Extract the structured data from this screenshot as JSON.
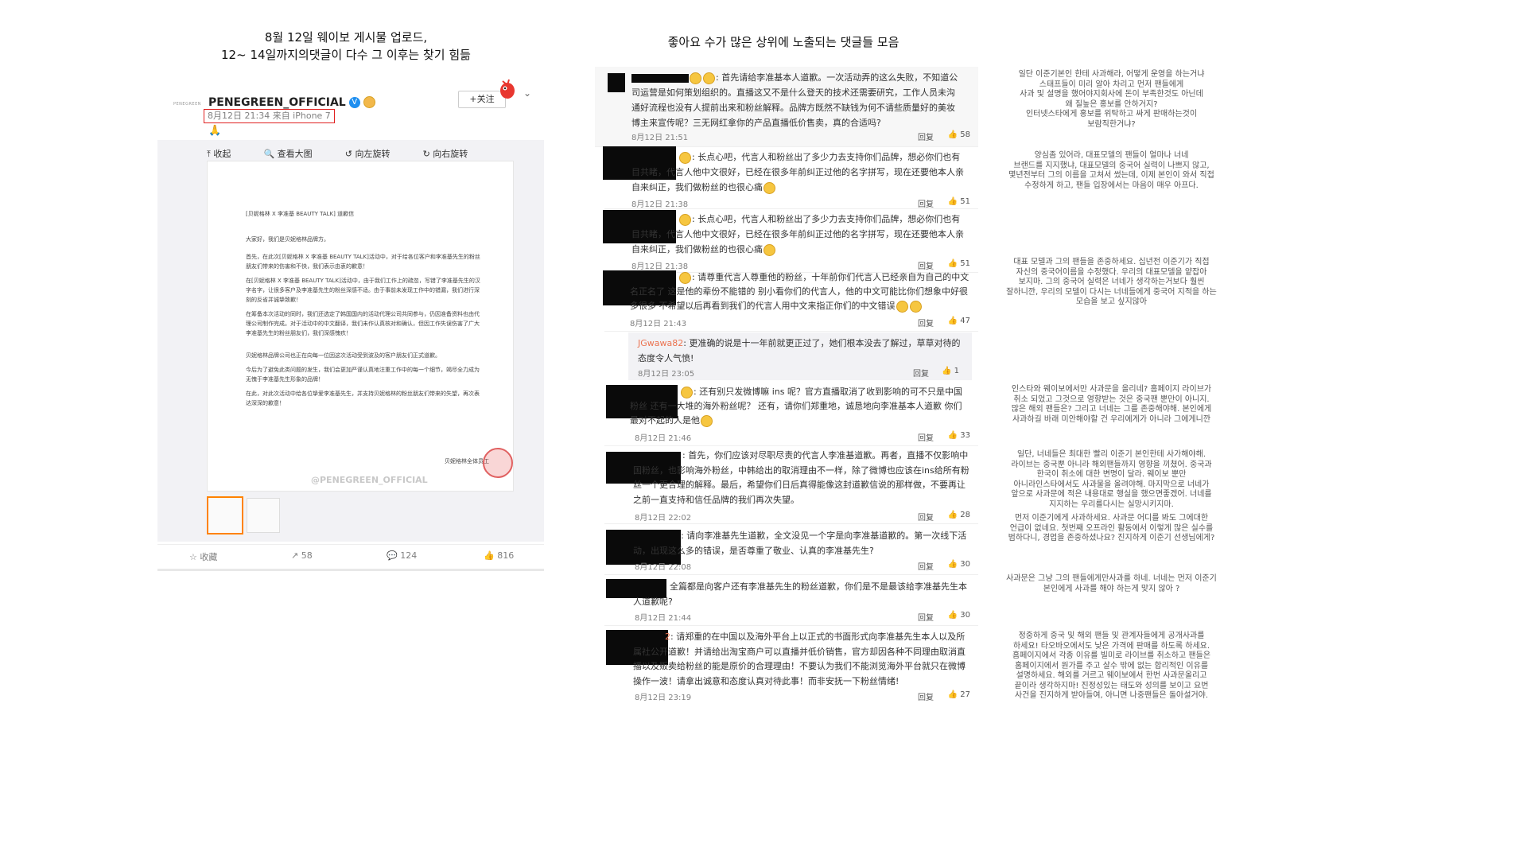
{
  "headers": {
    "left_line1": "8월 12일 웨이보 게시물 업로드,",
    "left_line2": "12~ 14일까지의댓글이 다수 그 이후는 찾기 힘듦",
    "right": "좋아요 수가 많은 상위에 노출되는 댓글들 모음"
  },
  "post": {
    "logo_text": "PENEGREEN",
    "account": "PENEGREEN_OFFICIAL",
    "verified": "V",
    "time": "8月12日 21:34 来自 iPhone 7",
    "follow": "+关注",
    "toolbar": [
      "收起",
      "查看大图",
      "向左旋转",
      "向右旋转"
    ],
    "document": {
      "title": "[贝妮格林 X 李准基 BEAUTY TALK] 道歉信",
      "greeting": "大家好，我们是贝妮格林品牌方。",
      "para1": "首先，在此次[贝妮格林 X 李准基 BEAUTY TALK]活动中，对于给各位客户和李准基先生的粉丝朋友们带来的伤害和不快，我们表示由衷的歉意！",
      "para2": "在[贝妮格林 X 李准基 BEAUTY TALK]活动中，由于我们工作上的疏忽，写错了李准基先生的汉字名字，让很多客户及李准基先生的粉丝深感不适。由于事前未发现工作中的错漏，我们进行深刻的反省并诚挚致歉！",
      "para3": "在筹备本次活动的同时，我们还选定了韩国国内的活动代理公司共同参与，仍因准备资料也由代理公司制作完成。对于活动中的中文翻译，我们未作认真核对和确认，但因工作失误伤害了广大李准基先生的粉丝朋友们，我们深感愧疚！",
      "para4": "贝妮格林品牌公司也正在向每一位因这次活动受到波及的客户朋友们正式道歉。",
      "para5": "今后为了避免此类问题的发生，我们会更加严谨认真地注重工作中的每一个细节，竭尽全力成为无愧于李准基先生形象的品牌！",
      "para6": "在此，对此次活动中给各位挚爱李准基先生，并支持贝妮格林的粉丝朋友们带来的失望，再次表达深深的歉意！",
      "signature": "贝妮格林全体员工",
      "watermark": "@PENEGREEN_OFFICIAL"
    },
    "actions": {
      "favorite": "收藏",
      "forward": "58",
      "comment": "124",
      "like": "816"
    }
  },
  "comments": [
    {
      "text": "首先请给李准基本人道歉。一次活动弄的这么失败，不知道公司运营是如何策划组织的。直播这又不是什么登天的技术还需要研究，工作人员未沟通好流程也没有人提前出来和粉丝解释。品牌方既然不缺钱为何不请些质量好的美妆博主来宣传呢？三无网红拿你的产品直播低价售卖，真的合适吗?",
      "date": "8月12日 21:51",
      "reply": "回复",
      "likes": "58"
    },
    {
      "text": "长点心吧，代言人和粉丝出了多少力去支持你们品牌，想必你们也有目共睹，代言人他中文很好，已经在很多年前纠正过他的名字拼写，现在还要他本人亲自来纠正，我们做粉丝的也很心痛",
      "date": "8月12日 21:38",
      "reply": "回复",
      "likes": "51"
    },
    {
      "text": "长点心吧，代言人和粉丝出了多少力去支持你们品牌，想必你们也有目共睹，代言人他中文很好，已经在很多年前纠正过他的名字拼写，现在还要他本人亲自来纠正，我们做粉丝的也很心痛",
      "date": "8月12日 21:38",
      "reply": "回复",
      "likes": "51"
    },
    {
      "text": "请尊重代言人尊重他的粉丝，十年前你们代言人已经亲自为自己的中文名正名了 这是他的辈份不能错的 别小看你们的代言人，他的中文可能比你们想象中好很多很多 不希望以后再看到我们的代言人用中文来指正你们的中文错误",
      "date": "8月12日 21:43",
      "reply": "回复",
      "likes": "47"
    },
    {
      "user": "JGwawa82",
      "text": "更准确的说是十一年前就更正过了，她们根本没去了解过，草草对待的态度令人气愤!",
      "date": "8月12日 23:05",
      "reply": "回复",
      "likes": "1"
    },
    {
      "text": "还有别只发微博嘛 ins 呢？官方直播取消了收到影响的可不只是中国粉丝 还有一大堆的海外粉丝呢？ 还有，请你们郑重地，诚恳地向李准基本人道歉 你们最对不起的人是他",
      "date": "8月12日 21:46",
      "reply": "回复",
      "likes": "33"
    },
    {
      "text": "首先，你们应该对尽职尽责的代言人李准基道歉。再者，直播不仅影响中国粉丝，也影响海外粉丝，中韩给出的取消理由不一样，除了微博也应该在ins给所有粉丝一个更合理的解释。最后，希望你们日后真得能像这封道歉信说的那样做，不要再让之前一直支持和信任品牌的我们再次失望。",
      "date": "8月12日 22:02",
      "reply": "回复",
      "likes": "28"
    },
    {
      "text": "请向李准基先生道歉，全文没见一个字是向李准基道歉的。第一次线下活动，出现这么多的错误，是否尊重了敬业、认真的李准基先生?",
      "date": "8月12日 22:08",
      "reply": "回复",
      "likes": "30"
    },
    {
      "text": "全篇都是向客户还有李准基先生的粉丝道歉，你们是不是最该给李准基先生本人道歉呢?",
      "date": "8月12日 21:44",
      "reply": "回复",
      "likes": "30"
    },
    {
      "user_suffix": "2",
      "text": "请郑重的在中国以及海外平台上以正式的书面形式向李准基先生本人以及所属社公开道歉！并请给出淘宝商户可以直播并低价销售，官方却因各种不同理由取消直播以及贩卖给粉丝的能是原价的合理理由！不要认为我们不能浏览海外平台就只在微博操作一波！请拿出诚意和态度认真对待此事！而非安抚一下粉丝情绪!",
      "date": "8月12日 23:19",
      "reply": "回复",
      "likes": "27"
    }
  ],
  "korean_notes": [
    "일단 이준기본인 한테 사과해라, 어떻게 운영을 하는거냐\n스태프들이 미리 알아 차리고 먼저 팬들에게\n사과 및 설명을 했어야지회사에 돈이 부족한것도 아닌데\n왜 질높은 홍보를 안하거지?\n인터넷스타에게 홍보를 위탁하고 싸게 판매하는것이\n보람직한거냐?",
    "양심좀 있어라, 대표모델의 팬들이 얼마나 너네\n브랜드를 지지했냐, 대표모델의 중국어 실력이 나쁘지 않고,\n몇년전부터 그의 이름을 고쳐서 썼는데, 이제 본인이 와서 직접\n수정하게 하고, 팬들 입장에서는 마음이 매우 아프다.",
    "대표 모델과 그의 팬들을 존중하세요. 십년전 이준기가 직접\n자신의 중국어이름을 수정했다. 우리의 대표모델을 얕잡아\n보지마. 그의 중국어 실력은 너네가 생각하는거보다 훨씬\n잘하니깐, 우리의 모델이 다시는 너네들에게 중국어 지적을 하는\n모습을 보고 싶지않아",
    "인스타와 웨이보에서만 사과문을 올리네? 홈페이지 라이브가\n취소 되었고 그것으로 영향받는 것은 중국팬 뿐만이 아니지.\n많은 해외 팬들은? 그리고 너네는 그를 존중해야해. 본인에게\n사과하길 바래 미안해야할 건 우리에게가 아니라 그에게니깐",
    "일단, 너네들은 최대한 빨리 이준기 본인한테 사가해야해.\n라이브는 중국뿐 아니라 해외팬들까지 영향을 끼쳤어. 중국과\n한국이 취소에 대한 변명이 달라. 웨이보 뿐만\n아니라인스타에서도 사과물을 올려야해. 마지막으로 너네가\n앞으로 사과문에 적은 내용대로 행실을 했으면좋겠어. 너네를\n지지하는 우리를다시는 실망시키지마.",
    "먼저 이준기에게 사과하세요. 사과문 어디를 봐도 그에대한\n언급이 없네요. 첫번째 오프라인 활동에서 이렇게 많은 실수를\n범하다니, 경업을 존중하셨나요?   진지하게 이준기 선생님에게?",
    "사과문은 그냥 그의 팬들에게만사과를 하네. 너네는 먼저 이준기\n본인에게 사과를 해야 하는게 맞지 않아 ?",
    "정중하게 중국 및 해외 팬들 및 관계자들에게 공개사과를\n하세요! 타오바오에서도 낮은 가격에 판매를 하도록 하세요.\n홈페이지에서 각종 이유를 빌미로 라이브를 취소하고 팬들은\n홈페이지에서 원가를 주고 살수 밖에 없는 합리적인 이유를\n설명하세요. 해외를 거르고 웨이보에서 한번 사과문올리고\n끝이라 생각하지마! 진정성있는 태도와 성의를 보이고 요번\n사건을 진지하게 받아들여, 아니면 나중팬들은 돌아설거야."
  ]
}
